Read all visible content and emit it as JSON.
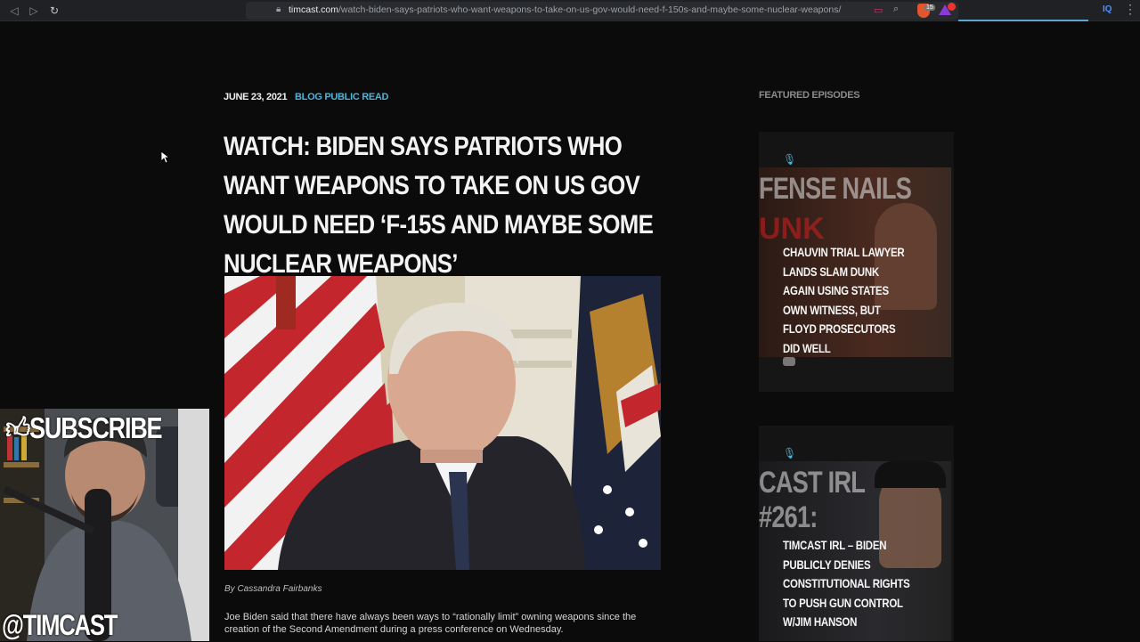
{
  "browser": {
    "url_domain": "timcast.com",
    "url_path": "/watch-biden-says-patriots-who-want-weapons-to-take-on-us-gov-would-need-f-150s-and-maybe-some-nuclear-weapons/",
    "extension_badge": "IQ",
    "shield_count": "15"
  },
  "article": {
    "date": "JUNE 23, 2021",
    "category": "BLOG PUBLIC READ",
    "headline": "WATCH: BIDEN SAYS PATRIOTS WHO WANT WEAPONS TO TAKE ON US GOV WOULD NEED ‘F-15S AND MAYBE SOME NUCLEAR WEAPONS’",
    "byline": "By Cassandra Fairbanks",
    "body": "Joe Biden said that there have always been ways to “rationally limit” owning weapons since the creation of the Second Amendment during a press conference on Wednesday."
  },
  "sidebar": {
    "title": "FEATURED EPISODES",
    "episodes": [
      {
        "thumb_text": "FENSE NAILS",
        "title": "CHAUVIN TRIAL LAWYER LANDS SLAM DUNK AGAIN USING STATES OWN WITNESS, BUT FLOYD PROSECUTORS DID WELL"
      },
      {
        "thumb_text_1": "CAST IRL",
        "thumb_text_2": "#261:",
        "title": "TIMCAST IRL – BIDEN PUBLICLY DENIES CONSTITUTIONAL RIGHTS TO PUSH GUN CONTROL W/JIM HANSON"
      }
    ]
  },
  "overlay": {
    "subscribe": "SUBSCRIBE",
    "handle": "@TIMCAST"
  },
  "colors": {
    "accent": "#4fb3d9",
    "background": "#0b0b0c"
  }
}
